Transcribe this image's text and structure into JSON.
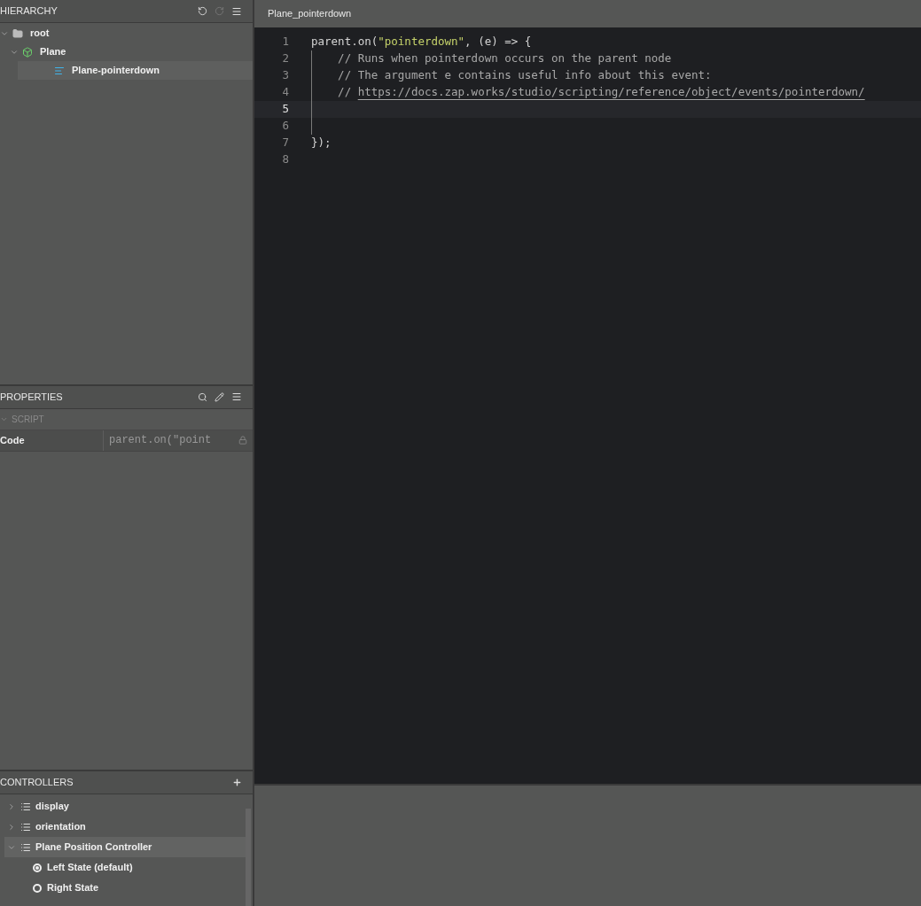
{
  "hierarchy": {
    "title": "HIERARCHY",
    "tree": [
      {
        "label": "root",
        "kind": "folder",
        "expanded": true,
        "selected": false,
        "children": [
          {
            "label": "Plane",
            "kind": "object",
            "expanded": true,
            "selected": false,
            "children": [
              {
                "label": "Plane-pointerdown",
                "kind": "script",
                "selected": true
              }
            ]
          }
        ]
      }
    ]
  },
  "properties": {
    "title": "PROPERTIES",
    "section": "SCRIPT",
    "rows": [
      {
        "label": "Code",
        "value": "parent.on(\"point",
        "locked": true
      }
    ]
  },
  "controllers": {
    "title": "CONTROLLERS",
    "items": [
      {
        "label": "display",
        "expanded": false,
        "selected": false
      },
      {
        "label": "orientation",
        "expanded": false,
        "selected": false
      },
      {
        "label": "Plane Position Controller",
        "expanded": true,
        "selected": true,
        "states": [
          {
            "label": "Left State (default)",
            "selected": true
          },
          {
            "label": "Right State",
            "selected": false
          }
        ]
      }
    ]
  },
  "editor": {
    "tab": "Plane_pointerdown",
    "lines": [
      {
        "number": "1",
        "current": false,
        "indent": false,
        "segments": [
          {
            "kind": "plain",
            "text": "parent.on("
          },
          {
            "kind": "string",
            "text": "\"pointerdown\""
          },
          {
            "kind": "plain",
            "text": ", (e) => {"
          }
        ]
      },
      {
        "number": "2",
        "current": false,
        "indent": true,
        "segments": [
          {
            "kind": "comment",
            "text": "    // Runs when pointerdown occurs on the parent node"
          }
        ]
      },
      {
        "number": "3",
        "current": false,
        "indent": true,
        "segments": [
          {
            "kind": "comment",
            "text": "    // The argument e contains useful info about this event:"
          }
        ]
      },
      {
        "number": "4",
        "current": false,
        "indent": true,
        "segments": [
          {
            "kind": "comment",
            "text": "    // "
          },
          {
            "kind": "link",
            "text": "https://docs.zap.works/studio/scripting/reference/object/events/pointerdown/"
          }
        ]
      },
      {
        "number": "5",
        "current": true,
        "indent": true
      },
      {
        "number": "6",
        "current": false,
        "indent": true
      },
      {
        "number": "7",
        "current": false,
        "indent": false,
        "segments": [
          {
            "kind": "plain",
            "text": "});"
          }
        ]
      },
      {
        "number": "8",
        "current": false,
        "indent": false
      }
    ]
  }
}
